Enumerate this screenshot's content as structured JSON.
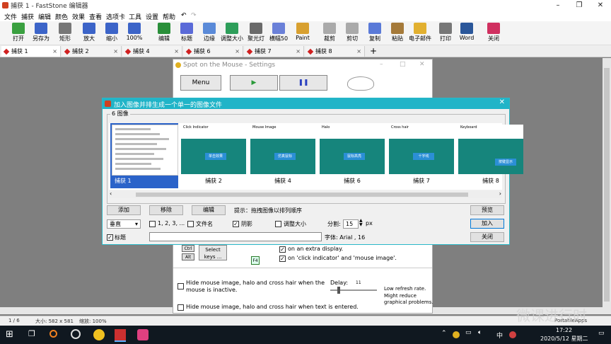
{
  "window": {
    "title": "捕获 1 - FastStone 编辑器"
  },
  "menu": [
    "文件",
    "捕获",
    "编辑",
    "颜色",
    "效果",
    "查看",
    "选项卡",
    "工具",
    "设置",
    "帮助"
  ],
  "toolbar": [
    {
      "label": "打开",
      "color": "#3aa040"
    },
    {
      "label": "另存为",
      "color": "#3c64c8"
    },
    {
      "label": "矩形",
      "color": "#777"
    },
    {
      "label": "放大",
      "color": "#3c64c8"
    },
    {
      "label": "缩小",
      "color": "#3c64c8"
    },
    {
      "label": "100%",
      "color": "#3c64c8"
    },
    {
      "label": "编辑",
      "color": "#2a8f3a"
    },
    {
      "label": "标题",
      "color": "#5a6ad8"
    },
    {
      "label": "边缘",
      "color": "#5a8ad8"
    },
    {
      "label": "调整大小",
      "color": "#2e9e5a"
    },
    {
      "label": "聚光灯",
      "color": "#6a6a6a"
    },
    {
      "label": "横幅50",
      "color": "#6a80d8"
    },
    {
      "label": "Paint",
      "color": "#d8a030"
    },
    {
      "label": "裁剪",
      "color": "#aaa"
    },
    {
      "label": "剪切",
      "color": "#aaa"
    },
    {
      "label": "复制",
      "color": "#5a7ad8"
    },
    {
      "label": "粘贴",
      "color": "#a57a3a"
    },
    {
      "label": "电子邮件",
      "color": "#e2b030"
    },
    {
      "label": "打印",
      "color": "#777"
    },
    {
      "label": "Word",
      "color": "#2b579a"
    },
    {
      "label": "关闭",
      "color": "#d03060"
    }
  ],
  "tabs": [
    "捕获 1",
    "捕获 2",
    "捕获 4",
    "捕获 6",
    "捕获 7",
    "捕获 8"
  ],
  "spot": {
    "title": "Spot on the Mouse - Settings",
    "menu_btn": "Menu",
    "select_keys": "Select keys ...",
    "ctrl": "Ctrl",
    "alt": "Alt",
    "f4": "F4",
    "opt1": "on an extra display.",
    "opt2": "on 'click indicator' and 'mouse image'.",
    "hide1": "Hide mouse image, halo and cross hair when the mouse is inactive.",
    "delay": "Delay:",
    "delay_val": "11",
    "low_rate": "Low refresh rate.",
    "might": "Might reduce graphical problems.",
    "hide2": "Hide mouse image, halo and cross hair when text is entered."
  },
  "dialog": {
    "title": "加入图像并排生成一个单一的图像文件",
    "group_label": "6 图像",
    "thumbs": [
      {
        "caption": "捕获 1",
        "head": "",
        "btn": ""
      },
      {
        "caption": "捕获 2",
        "head": "Click Indicator",
        "btn": "单击效果"
      },
      {
        "caption": "捕获 4",
        "head": "Mouse Image",
        "btn": "仿真鼠标"
      },
      {
        "caption": "捕获 6",
        "head": "Halo",
        "btn": "鼠标高亮"
      },
      {
        "caption": "捕获 7",
        "head": "Cross hair",
        "btn": "十字线"
      },
      {
        "caption": "捕获 8",
        "head": "Keyboard",
        "btn": "按键显示"
      }
    ],
    "add": "添加",
    "remove": "移除",
    "edit": "编辑",
    "hint": "提示：拖拽图像以排列顺序",
    "preview": "预览",
    "join": "加入",
    "close": "关闭",
    "orientation": "垂直",
    "numbering": "1, 2, 3, ...",
    "filename": "文件名",
    "shadow": "阴影",
    "resize": "调整大小",
    "split_label": "分割:",
    "split_val": "15",
    "split_unit": "px",
    "caption_label": "标题",
    "font_info": "字体: Arial , 16"
  },
  "status": {
    "page": "1 / 6",
    "size": "大小: 582 x 581",
    "zoom": "缩放: 100%",
    "app": "PortableApps"
  },
  "clock": {
    "time": "17:22",
    "date": "2020/5/12 星期二"
  },
  "tray": {
    "ime": "中"
  },
  "watermark": "微课进行时"
}
